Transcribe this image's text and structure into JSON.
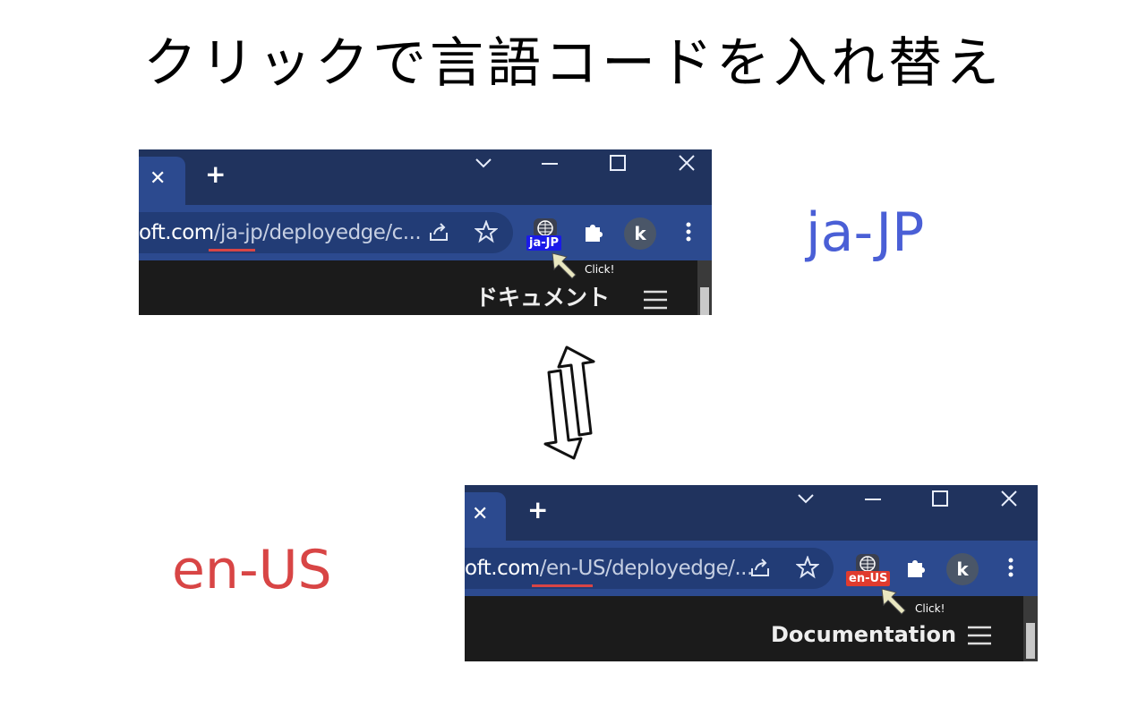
{
  "title": "クリックで言語コードを入れ替え",
  "top_label": {
    "text": "ja-JP",
    "color": "#4a5fd6"
  },
  "bottom_label": {
    "text": "en-US",
    "color": "#d84545"
  },
  "screens": [
    {
      "url_host": "oft.com",
      "url_path": "/ja-jp/deployedge/c...",
      "badge": {
        "text": "ja-JP",
        "color": "#1a1ae8"
      },
      "avatar": "k",
      "click_hint": "Click!",
      "doc_title": "ドキュメント"
    },
    {
      "url_host": "oft.com",
      "url_path": "/en-US/deployedge/...",
      "badge": {
        "text": "en-US",
        "color": "#e03b2e"
      },
      "avatar": "k",
      "click_hint": "Click!",
      "doc_title": "Documentation"
    }
  ],
  "icons": {
    "tab_close": "✕",
    "new_tab": "+",
    "window": [
      "chevron-down-icon",
      "minimize-icon",
      "maximize-icon",
      "close-icon"
    ],
    "toolbar": [
      "share-icon",
      "star-icon",
      "translate-extension-icon",
      "puzzle-icon",
      "avatar",
      "kebab-menu-icon"
    ]
  }
}
